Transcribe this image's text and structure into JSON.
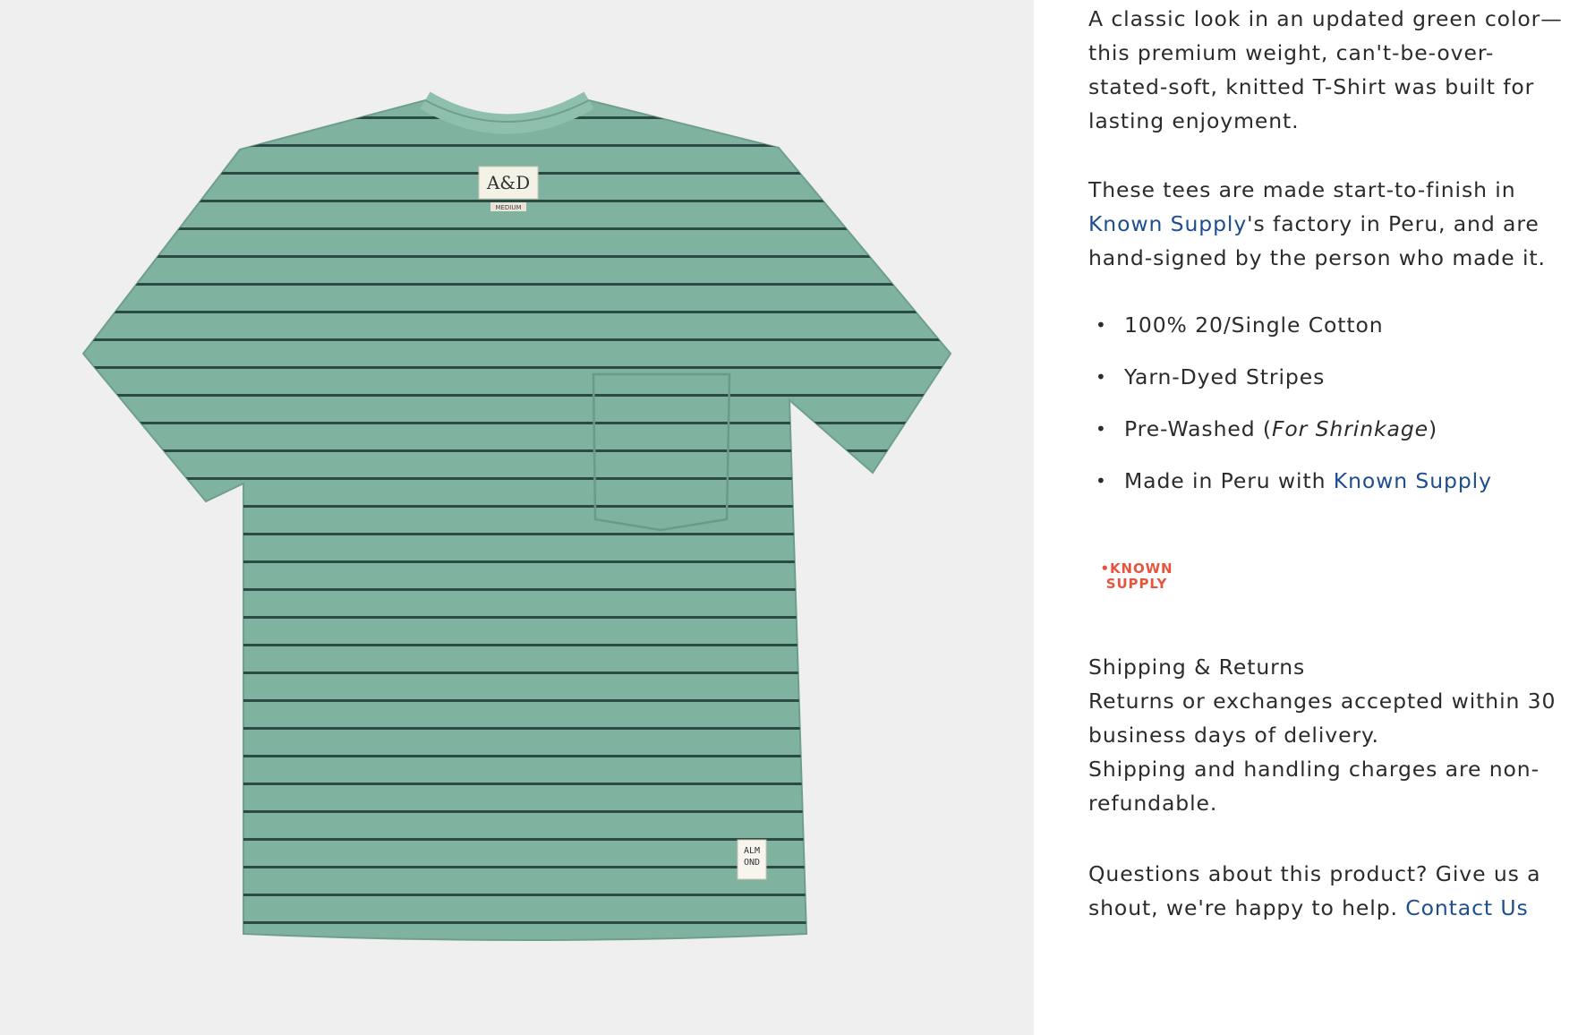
{
  "gallery": {
    "image_alt": "Green striped pocket t-shirt",
    "neck_label": "A&D",
    "neck_sub": "MEDIUM",
    "hem_label_line1": "ALM",
    "hem_label_line2": "OND"
  },
  "description": {
    "paragraph1": "A classic look in an updated green color—this premium weight, can't-be-over-stated-soft, knitted T-Shirt was built for lasting enjoyment.",
    "paragraph2_before": "These tees are made start-to-finish in ",
    "paragraph2_link": "Known Supply",
    "paragraph2_after": "'s factory in Peru, and are hand-signed by the person who made it.",
    "features": {
      "item1": "100% 20/Single Cotton",
      "item2": "Yarn-Dyed Stripes",
      "item3_before": "Pre-Washed (",
      "item3_em": "For Shrinkage",
      "item3_after": ")",
      "item4_before": "Made in Peru with ",
      "item4_link": "Known Supply"
    },
    "logo": {
      "line1": "•KNOWN",
      "line2": "SUPPLY",
      "color": "#e8553f"
    },
    "shipping": {
      "heading": "Shipping & Returns",
      "line1": "Returns or exchanges accepted within 30 business days of delivery.",
      "line2": "Shipping and handling charges are non-refundable."
    },
    "contact": {
      "text": "Questions about this product? Give us a shout, we're happy to help. ",
      "link": "Contact Us"
    }
  },
  "colors": {
    "shirt": "#7fb39f",
    "stripe": "#2b4a44",
    "link": "#1f4e8c",
    "gallery_bg": "#efefef"
  }
}
